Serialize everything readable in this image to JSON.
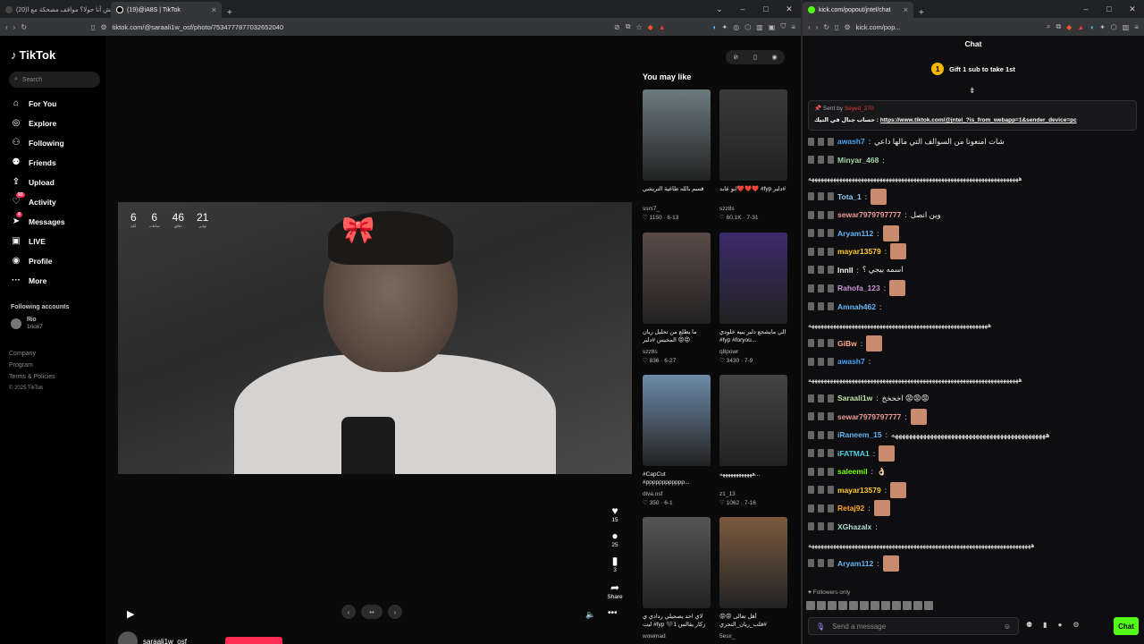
{
  "left_browser": {
    "tabs": [
      {
        "label": "(20)لبش أنا حولا؟ مواقف مضحكة مع ا...",
        "active": false
      },
      {
        "label": "(19)@iA8S | TikTok",
        "active": true
      }
    ],
    "url": "tiktok.com/@saraali1w_osf/photo/7534777877032652040"
  },
  "tiktok": {
    "logo": "TikTok",
    "search_placeholder": "Search",
    "nav": [
      {
        "label": "For You",
        "icon": "home-icon"
      },
      {
        "label": "Explore",
        "icon": "compass-icon"
      },
      {
        "label": "Following",
        "icon": "following-icon"
      },
      {
        "label": "Friends",
        "icon": "friends-icon"
      },
      {
        "label": "Upload",
        "icon": "upload-icon"
      },
      {
        "label": "Activity",
        "icon": "activity-icon",
        "badge": "93"
      },
      {
        "label": "Messages",
        "icon": "messages-icon",
        "badge": "4"
      },
      {
        "label": "LIVE",
        "icon": "live-icon"
      },
      {
        "label": "Profile",
        "icon": "profile-icon"
      },
      {
        "label": "More",
        "icon": "more-icon"
      }
    ],
    "following_header": "Following accounts",
    "following": [
      {
        "name": "Rio",
        "handle": "1riox7"
      }
    ],
    "footer": [
      "Company",
      "Program",
      "Terms & Policies",
      "© 2025 TikTok"
    ],
    "countdown": [
      {
        "value": "6",
        "label": "أيام"
      },
      {
        "value": "6",
        "label": "ساعات"
      },
      {
        "value": "46",
        "label": "دقائق"
      },
      {
        "value": "21",
        "label": "ثواني"
      }
    ],
    "actions": [
      {
        "icon": "heart-icon",
        "count": "15"
      },
      {
        "icon": "comment-icon",
        "count": "25"
      },
      {
        "icon": "bookmark-icon",
        "count": "3"
      },
      {
        "icon": "share-icon",
        "count": "Share"
      }
    ],
    "author": "saraali1w_osf",
    "you_may_like": "You may like",
    "cards": [
      {
        "caption": "قسم بالله طاغية التريشي",
        "user": "ssrx7_",
        "likes": "1150",
        "date": "6-13",
        "bg": "#6b7b80"
      },
      {
        "caption": "ابو عابد❤️❤️❤️ #fyp دلبر#",
        "user": "szz8s",
        "likes": "60.1K",
        "date": "7-31",
        "bg": "#3a3a3a"
      },
      {
        "caption": "ما يطلع من تحليل ريان المخيس #دلبر 😡😡",
        "user": "szz8s",
        "likes": "836",
        "date": "6-27",
        "bg": "#5a4a45"
      },
      {
        "caption": "الي مايشجع دلبر يبيه خلودي #fyp #foryou...",
        "user": "q8powr",
        "likes": "3430",
        "date": "7-9",
        "bg": "#3b2a6a"
      },
      {
        "caption": "#CapCut #pppppppppppp...",
        "user": "diva.osf",
        "likes": "350",
        "date": "6-1",
        "bg": "#6e8aa8"
      },
      {
        "caption": "ههههههههههههه...",
        "user": "z1_13",
        "likes": "1062",
        "date": "7-16",
        "bg": "#444"
      },
      {
        "caption": "لاي احد يصحيلي ردادي ي ليت #fyp 🖤1 زكار يقالس",
        "user": "wowmad",
        "likes": "",
        "date": "",
        "bg": "#555"
      },
      {
        "caption": "أهل تعالى 😡😡 #قلب_ريان_التحري",
        "user": "5esx_",
        "likes": "",
        "date": "",
        "bg": "#7a5a40"
      }
    ]
  },
  "right_browser": {
    "tab_label": "kick.com/popout/jntel/chat",
    "url": "kick.com/pop..."
  },
  "kick": {
    "title": "Chat",
    "gift": {
      "coin": "1",
      "text": "Gift 1 sub to take 1st"
    },
    "pinned": {
      "sent_by_label": "Sent by",
      "sender": "Seyed_270",
      "message_prefix": "حساب جنال في التيك :",
      "link": "https://www.tiktok.com/@jntel_?is_from_webapp=1&sender_device=pc"
    },
    "messages": [
      {
        "user": "awash7",
        "color": "#42a5f5",
        "text": "شات امنعونا من السوالف التي مالها داعي",
        "emote": false
      },
      {
        "user": "Minyar_468",
        "color": "#a5d6a7",
        "text": "",
        "emote": false
      },
      {
        "user": "",
        "color": "#fff",
        "text": "ههههههههههههههههههههههههههههههههههههههههههههههههههههههههههههههههههههه",
        "spam": true
      },
      {
        "user": "Tota_1",
        "color": "#90caf9",
        "text": "",
        "emote": true
      },
      {
        "user": "sewar7979797777",
        "color": "#ef9a9a",
        "text": "وين انصل",
        "emote": false
      },
      {
        "user": "Aryam112",
        "color": "#64b5f6",
        "text": "",
        "emote": true
      },
      {
        "user": "mayar13579",
        "color": "#ffca28",
        "text": "",
        "emote": true
      },
      {
        "user": "lnnll",
        "color": "#fff",
        "text": "اسمه بيجي ؟",
        "emote": false
      },
      {
        "user": "Rahofa_123",
        "color": "#ce93d8",
        "text": "",
        "emote": true
      },
      {
        "user": "Amnah462",
        "color": "#64b5f6",
        "text": "",
        "emote": false
      },
      {
        "user": "",
        "color": "#fff",
        "text": "ههههههههههههههههههههههههههههههههههههههههههههههههههههههههههه",
        "spam": true
      },
      {
        "user": "GiBw",
        "color": "#ffab91",
        "text": "",
        "emote": true
      },
      {
        "user": "awash7",
        "color": "#42a5f5",
        "text": "",
        "emote": false
      },
      {
        "user": "",
        "color": "#fff",
        "text": "ههههههههههههههههههههههههههههههههههههههههههههههههههههههههههههههههههههه",
        "spam": true
      },
      {
        "user": "Saraali1w",
        "color": "#c5e1a5",
        "text": "اخخخخ 😡😡😡",
        "emote": false
      },
      {
        "user": "sewar7979797777",
        "color": "#ef9a9a",
        "text": "",
        "emote": true
      },
      {
        "user": "iRaneem_15",
        "color": "#64b5f6",
        "text": "ههههههههههههههههههههههههههههههههههههههههههههه",
        "emote": false
      },
      {
        "user": "iFATMA1",
        "color": "#4dd0e1",
        "text": "",
        "emote": true
      },
      {
        "user": "saleemil",
        "color": "#76ff03",
        "text": "👌🏻",
        "emote": false
      },
      {
        "user": "mayar13579",
        "color": "#ffca28",
        "text": "",
        "emote": true
      },
      {
        "user": "Retaj92",
        "color": "#ffa726",
        "text": "",
        "emote": true
      },
      {
        "user": "XGhazalx",
        "color": "#b2dfdb",
        "text": "",
        "emote": false
      },
      {
        "user": "",
        "color": "#fff",
        "text": "ههههههههههههههههههههههههههههههههههههههههههههههههههههههههههههههههههههههههه",
        "spam": true
      },
      {
        "user": "Aryam112",
        "color": "#64b5f6",
        "text": "",
        "emote": true
      }
    ],
    "followers_only": "Followers only",
    "send_placeholder": "Send a message",
    "chat_button": "Chat"
  }
}
